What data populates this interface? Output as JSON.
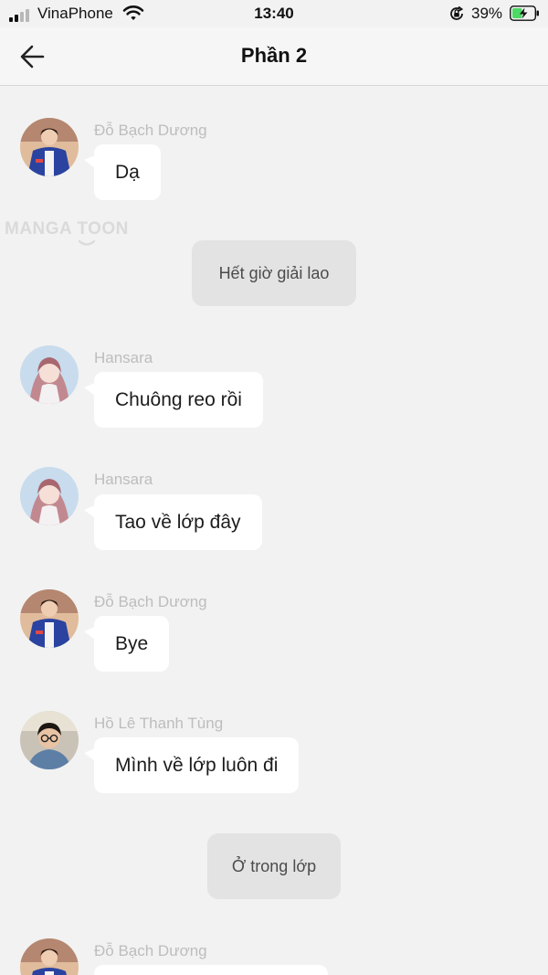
{
  "status_bar": {
    "carrier": "VinaPhone",
    "time": "13:40",
    "battery_percent": "39%",
    "signal_bars": 2,
    "signal_bars_total": 4
  },
  "header": {
    "title": "Phần 2",
    "back_icon": "arrow-left-icon"
  },
  "watermark": "MANGA TOON",
  "colors": {
    "background": "#f2f2f2",
    "bubble": "#ffffff",
    "narration": "#e3e3e3",
    "sender_name": "#bdbdbd",
    "battery_charging": "#4cd964"
  },
  "messages": [
    {
      "type": "chat",
      "sender": "Đỗ Bạch Dương",
      "text": "Dạ",
      "avatar": "boy-blue-jacket"
    },
    {
      "type": "narration",
      "text": "Hết giờ giải lao"
    },
    {
      "type": "chat",
      "sender": "Hansara",
      "text": "Chuông reo rồi",
      "avatar": "girl-pink-hair"
    },
    {
      "type": "chat",
      "sender": "Hansara",
      "text": "Tao về lớp đây",
      "avatar": "girl-pink-hair"
    },
    {
      "type": "chat",
      "sender": "Đỗ Bạch Dương",
      "text": "Bye",
      "avatar": "boy-blue-jacket"
    },
    {
      "type": "chat",
      "sender": "Hồ Lê Thanh Tùng",
      "text": "Mình về lớp luôn đi",
      "avatar": "boy-glasses"
    },
    {
      "type": "narration",
      "text": "Ở trong lớp"
    },
    {
      "type": "chat",
      "sender": "Đỗ Bạch Dương",
      "text": "",
      "avatar": "boy-blue-jacket"
    }
  ]
}
